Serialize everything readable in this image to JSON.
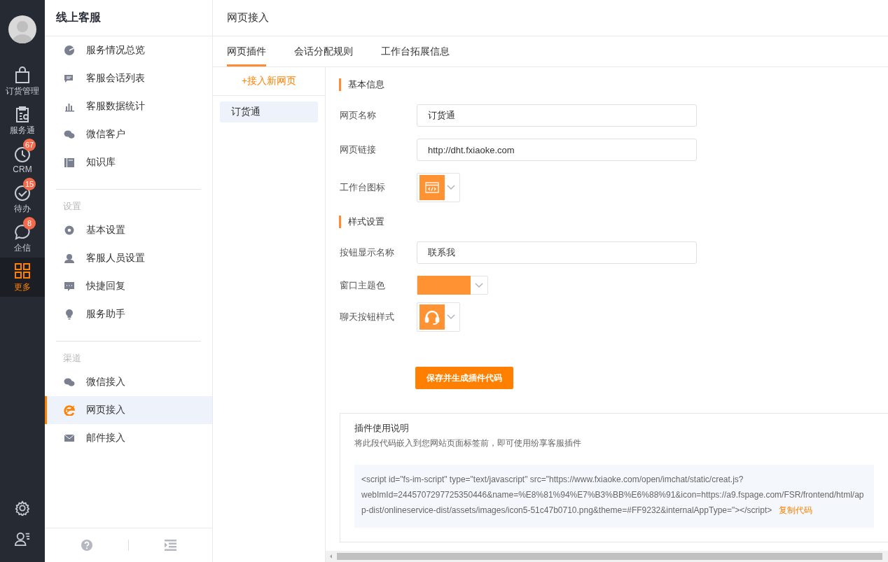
{
  "rail": {
    "items": [
      {
        "label": "订货管理",
        "selected": false
      },
      {
        "label": "服务通",
        "selected": false
      },
      {
        "label": "CRM",
        "badge": "67",
        "selected": false
      },
      {
        "label": "待办",
        "badge": "15",
        "selected": false
      },
      {
        "label": "企信",
        "badge": "8",
        "selected": false
      },
      {
        "label": "更多",
        "selected": true
      }
    ]
  },
  "sidebar": {
    "title": "线上客服",
    "groups": [
      {
        "items": [
          {
            "label": "服务情况总览",
            "selected": false
          },
          {
            "label": "客服会话列表",
            "selected": false
          },
          {
            "label": "客服数据统计",
            "selected": false
          },
          {
            "label": "微信客户",
            "selected": false
          },
          {
            "label": "知识库",
            "selected": false
          }
        ]
      },
      {
        "heading": "设置",
        "items": [
          {
            "label": "基本设置",
            "selected": false
          },
          {
            "label": "客服人员设置",
            "selected": false
          },
          {
            "label": "快捷回复",
            "selected": false
          },
          {
            "label": "服务助手",
            "selected": false
          }
        ]
      },
      {
        "heading": "渠道",
        "items": [
          {
            "label": "微信接入",
            "selected": false
          },
          {
            "label": "网页接入",
            "selected": true
          },
          {
            "label": "邮件接入",
            "selected": false
          }
        ]
      }
    ]
  },
  "page": {
    "title": "网页接入",
    "tabs": [
      {
        "label": "网页插件",
        "selected": true
      },
      {
        "label": "会话分配规则",
        "selected": false
      },
      {
        "label": "工作台拓展信息",
        "selected": false
      }
    ],
    "pages_list": {
      "add_label": "+接入新网页",
      "items": [
        {
          "label": "订货通",
          "selected": true
        }
      ]
    },
    "sections": [
      {
        "heading": "基本信息",
        "fields": [
          {
            "kind": "text",
            "label": "网页名称",
            "value": "订货通"
          },
          {
            "kind": "text",
            "label": "网页链接",
            "value": "http://dht.fxiaoke.com"
          },
          {
            "kind": "icon",
            "label": "工作台图标"
          }
        ]
      },
      {
        "heading": "样式设置",
        "fields": [
          {
            "kind": "text",
            "label": "按钮显示名称",
            "value": "联系我"
          },
          {
            "kind": "color",
            "label": "窗口主题色",
            "color": "#ff9232"
          },
          {
            "kind": "icon",
            "label": "聊天按钮样式"
          }
        ]
      }
    ],
    "save_button": "保存并生成插件代码",
    "instructions": {
      "title": "插件使用说明",
      "description": "将此段代码嵌入到您网站页面标签前，即可使用纷享客服插件",
      "code": "<script id=\"fs-im-script\" type=\"text/javascript\" src=\"https://www.fxiaoke.com/open/imchat/static/creat.js?webImId=2445707297725350446&name=%E8%81%94%E7%B3%BB%E6%88%91&icon=https://a9.fspage.com/FSR/frontend/html/app-dist/onlineservice-dist/assets/images/icon5-51c47b0710.png&theme=#FF9232&internalAppType=\"></script>",
      "copy_label": "复制代码"
    }
  }
}
